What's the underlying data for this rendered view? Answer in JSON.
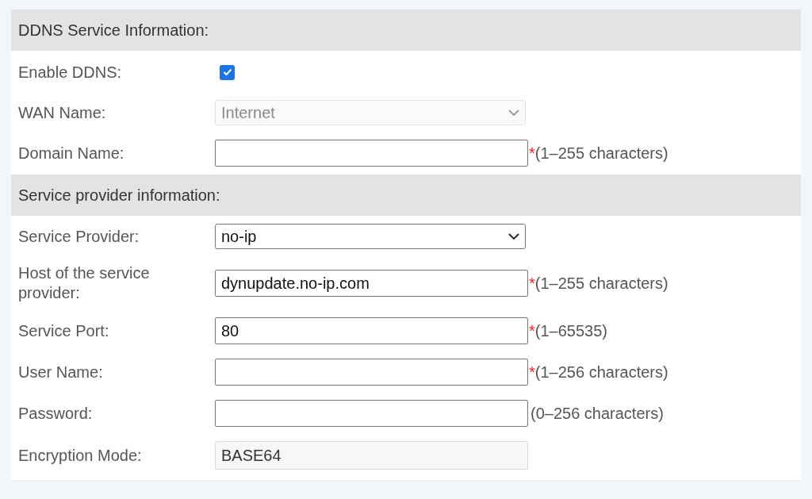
{
  "sections": [
    {
      "title": "DDNS Service Information:",
      "fields": [
        {
          "kind": "checkbox",
          "label": "Enable DDNS:",
          "checked": true
        },
        {
          "kind": "select",
          "label": "WAN Name:",
          "value": "Internet",
          "disabled": true
        },
        {
          "kind": "text",
          "label": "Domain Name:",
          "required_mark": "*",
          "hint": "(1–255 characters)"
        }
      ]
    },
    {
      "title": "Service provider information:",
      "fields": [
        {
          "kind": "select",
          "label": "Service Provider:",
          "value": "no-ip",
          "disabled": false
        },
        {
          "kind": "text",
          "label": "Host of the service provider:",
          "value": "dynupdate.no-ip.com",
          "required_mark": "*",
          "hint": "(1–255 characters)"
        },
        {
          "kind": "text",
          "label": "Service Port:",
          "value": "80",
          "required_mark": "*",
          "hint": "(1–65535)"
        },
        {
          "kind": "text",
          "label": "User Name:",
          "required_mark": "*",
          "hint": "(1–256 characters)"
        },
        {
          "kind": "text",
          "label": "Password:",
          "hint": "(0–256 characters)"
        },
        {
          "kind": "readonly",
          "label": "Encryption Mode:",
          "value": "BASE64"
        }
      ]
    }
  ]
}
